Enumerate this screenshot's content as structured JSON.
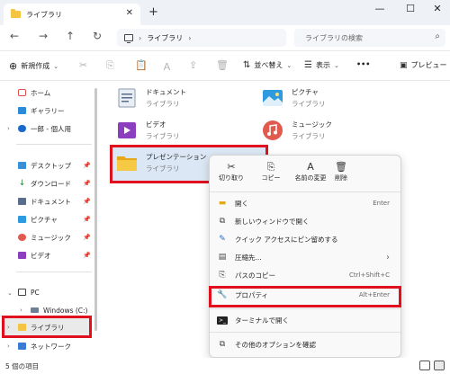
{
  "window": {
    "tab_title": "ライブラリ",
    "new_tab": "+",
    "minimize": "—",
    "maximize": "☐",
    "close": "✕"
  },
  "address": {
    "breadcrumb": [
      "ライブラリ"
    ],
    "search_placeholder": "ライブラリの検索"
  },
  "toolbar": {
    "new_label": "新規作成",
    "sort_label": "並べ替え",
    "view_label": "表示",
    "more_label": "•••",
    "preview_label": "プレビュー"
  },
  "sidebar": {
    "home": "ホーム",
    "gallery": "ギャラリー",
    "personal": "一郎 - 個人用",
    "desktop": "デスクトップ",
    "downloads": "ダウンロード",
    "documents": "ドキュメント",
    "pictures": "ピクチャ",
    "music": "ミュージック",
    "videos": "ビデオ",
    "pc": "PC",
    "windows_c": "Windows (C:)",
    "libraries": "ライブラリ",
    "network": "ネットワーク"
  },
  "libraries": [
    {
      "name": "ドキュメント",
      "sub": "ライブラリ",
      "icon": "documents-library-icon"
    },
    {
      "name": "ピクチャ",
      "sub": "ライブラリ",
      "icon": "pictures-library-icon"
    },
    {
      "name": "ビデオ",
      "sub": "ライブラリ",
      "icon": "videos-library-icon"
    },
    {
      "name": "ミュージック",
      "sub": "ライブラリ",
      "icon": "music-library-icon"
    },
    {
      "name": "プレゼンテーション",
      "sub": "ライブラリ",
      "icon": "folder-icon"
    }
  ],
  "context_menu": {
    "top": [
      {
        "label": "切り取り",
        "icon": "✂"
      },
      {
        "label": "コピー",
        "icon": "⎘"
      },
      {
        "label": "名前の変更",
        "icon": "A"
      },
      {
        "label": "削除",
        "icon": "🗑"
      }
    ],
    "items": [
      {
        "label": "開く",
        "shortcut": "Enter"
      },
      {
        "label": "新しいウィンドウで開く",
        "shortcut": ""
      },
      {
        "label": "クイック アクセスにピン留めする",
        "shortcut": ""
      },
      {
        "label": "圧縮先...",
        "shortcut": "›"
      },
      {
        "label": "パスのコピー",
        "shortcut": "Ctrl+Shift+C"
      },
      {
        "label": "プロパティ",
        "shortcut": "Alt+Enter"
      },
      {
        "label": "ターミナルで開く",
        "shortcut": ""
      },
      {
        "label": "その他のオプションを確認",
        "shortcut": ""
      }
    ]
  },
  "status": {
    "item_count": "5 個の項目"
  },
  "colors": {
    "highlight_border": "#e0101e",
    "selection_bg": "#dbe7f4",
    "accent": "#0067c0"
  }
}
